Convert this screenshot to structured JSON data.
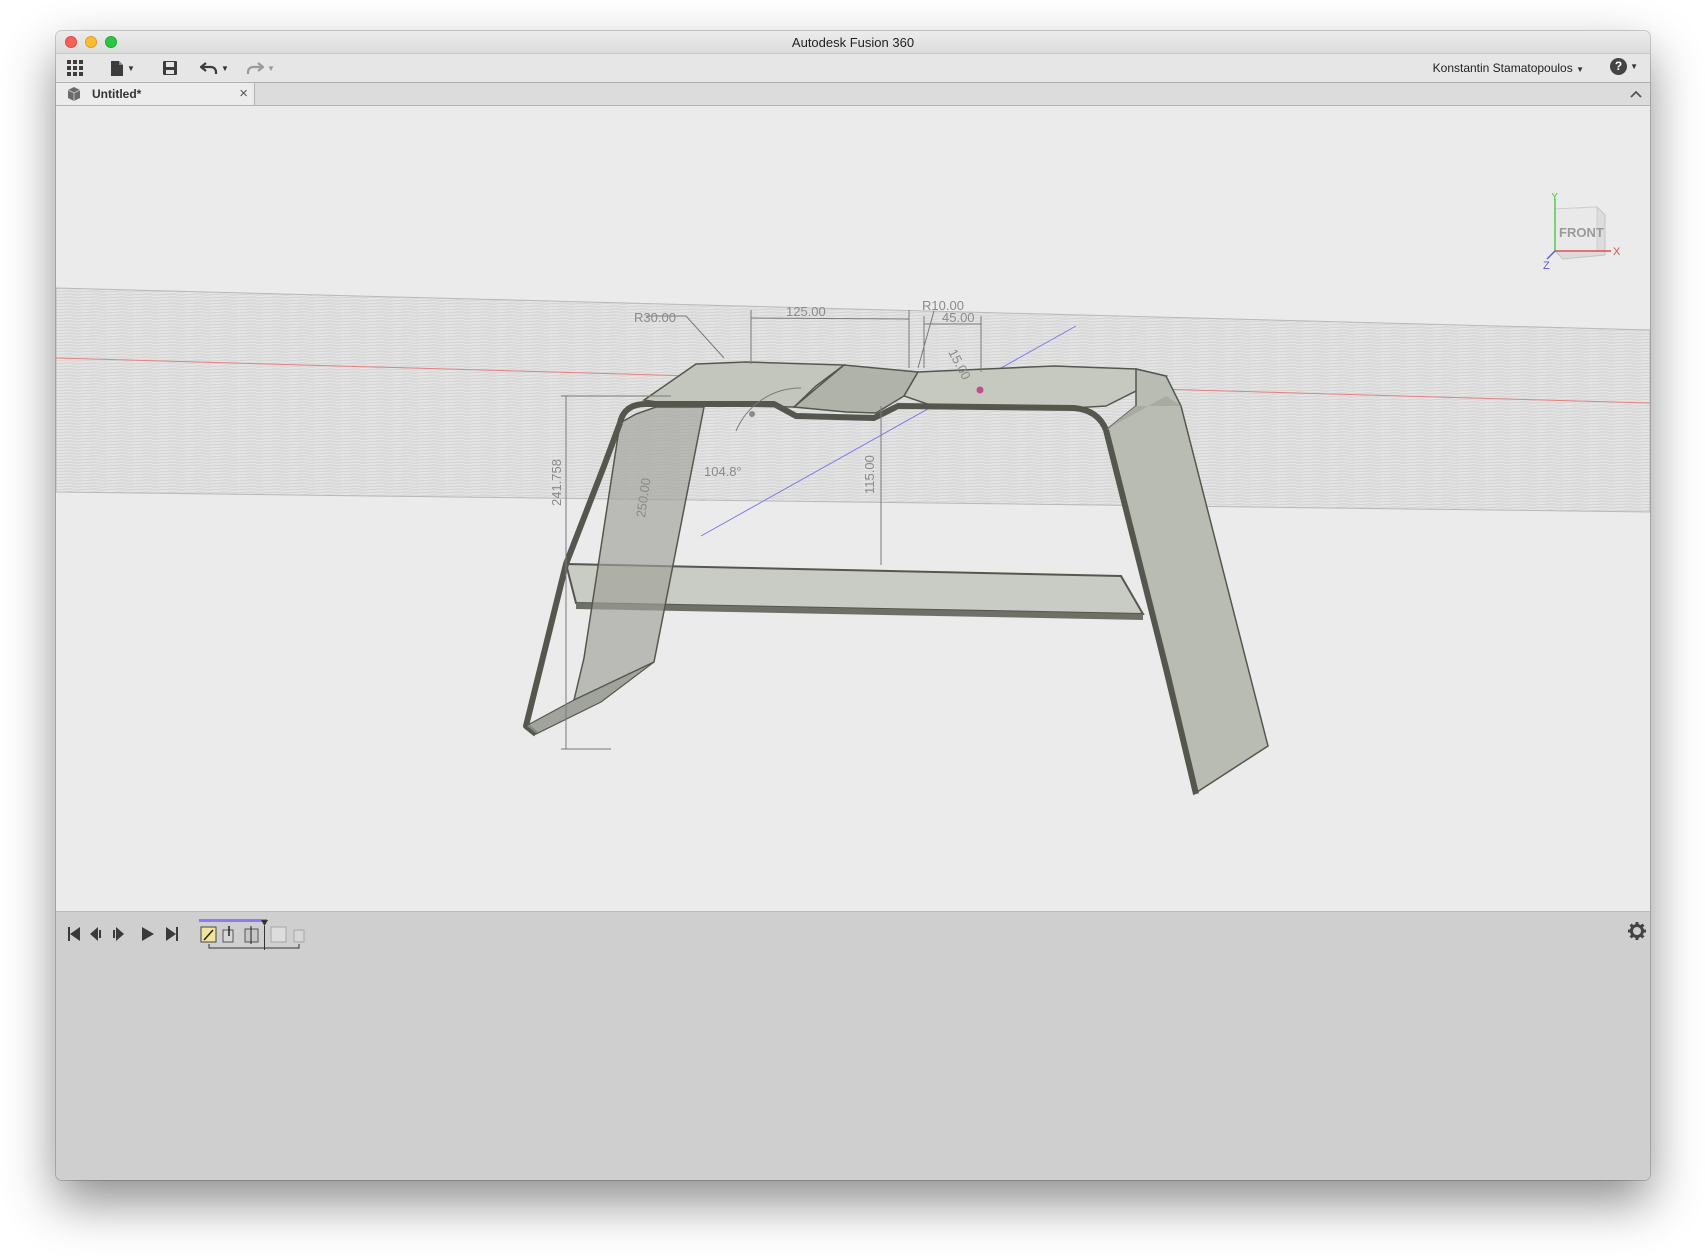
{
  "app": {
    "window_title": "Autodesk Fusion 360"
  },
  "toolbar": {
    "user_name": "Konstantin Stamatopoulos"
  },
  "document_tab": {
    "label": "Untitled*"
  },
  "viewcube": {
    "face_label": "FRONT",
    "axis_y": "Y",
    "axis_x": "X",
    "axis_z": "Z"
  },
  "sketch_dimensions": {
    "radius_large": "R30.00",
    "width_top": "125.00",
    "radius_small": "R10.00",
    "offset": "45.00",
    "slot_depth": "15.00",
    "height_overall": "241.758",
    "leg_length": "250.00",
    "angle": "104.8°",
    "shelf_height": "115.00"
  },
  "colors": {
    "window_bg": "#ececec",
    "viewport_bg": "#ebebeb",
    "timeline_bg": "#cfcfcf",
    "model_fill": "#c3c6bf",
    "model_edge": "#55574f",
    "x_axis": "#e05050",
    "z_axis": "#6a6ae0"
  },
  "icons": {
    "data_panel": "grid-icon",
    "file": "file-icon",
    "save": "save-icon",
    "undo": "undo-icon",
    "redo": "redo-icon",
    "help": "help-icon",
    "settings": "gear-icon"
  }
}
